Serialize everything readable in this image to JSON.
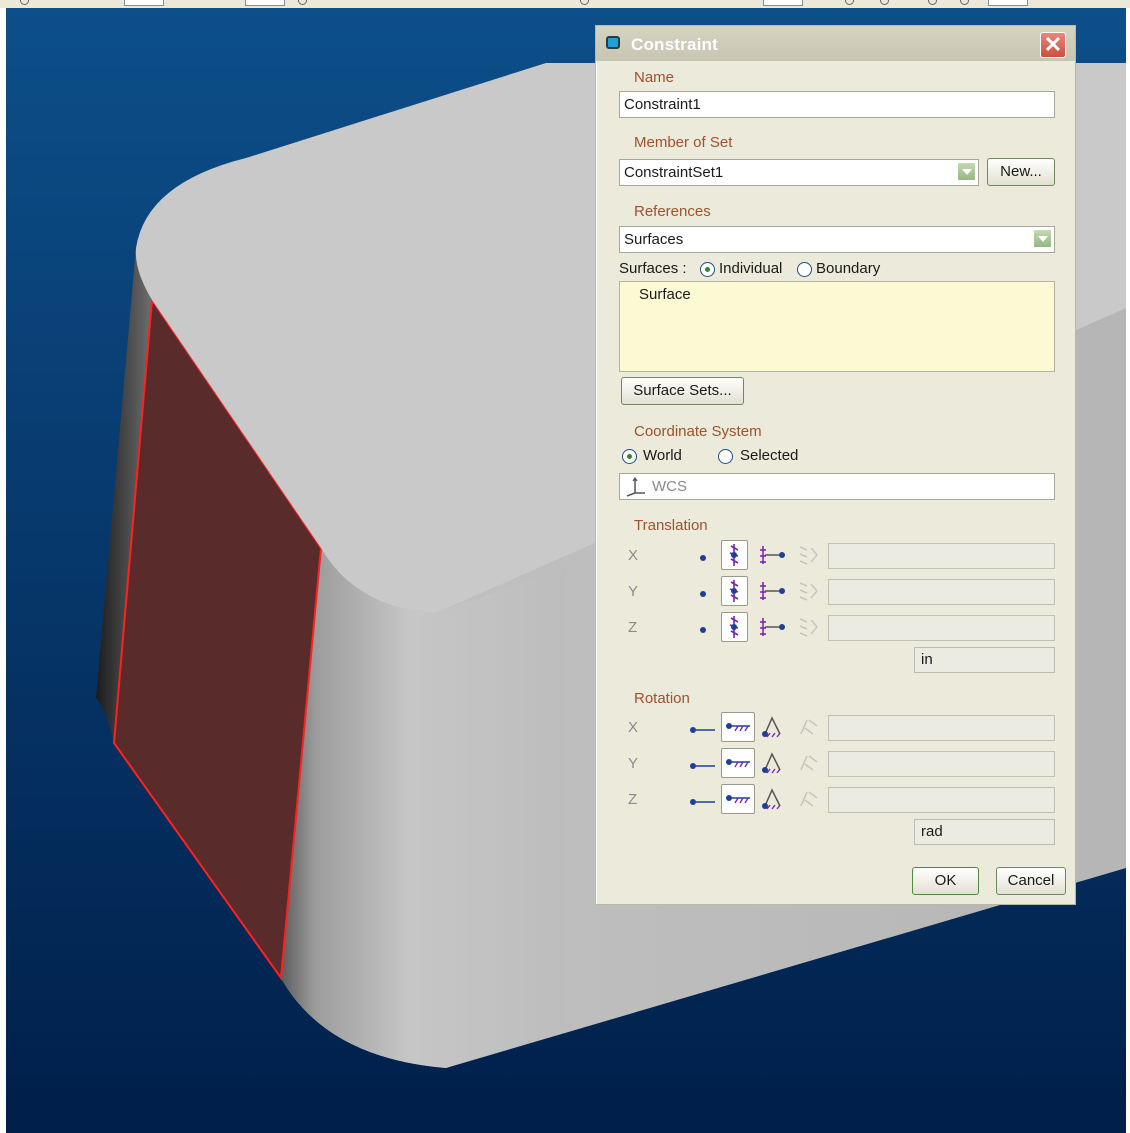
{
  "colors": {
    "viewport_top": "#0d4f8a",
    "viewport_bottom": "#001f4a",
    "selected_face": "#5a2b2b",
    "edge_highlight": "#ff2020",
    "label": "#a0522d"
  },
  "dialog": {
    "title": "Constraint",
    "close_label": "✕",
    "name": {
      "label": "Name",
      "value": "Constraint1"
    },
    "member_of_set": {
      "label": "Member of Set",
      "value": "ConstraintSet1",
      "new_button": "New..."
    },
    "references": {
      "label": "References",
      "value": "Surfaces"
    },
    "surfaces_mode": {
      "label": "Surfaces :",
      "options": [
        "Individual",
        "Boundary"
      ],
      "selected": "Individual"
    },
    "surface_list": [
      "Surface"
    ],
    "surface_sets_button": "Surface Sets...",
    "coordinate_system": {
      "label": "Coordinate System",
      "options": [
        "World",
        "Selected"
      ],
      "selected": "World",
      "value": "WCS"
    },
    "translation": {
      "label": "Translation",
      "axes": [
        "X",
        "Y",
        "Z"
      ],
      "unit": "in",
      "selected_mode": "fixed"
    },
    "rotation": {
      "label": "Rotation",
      "axes": [
        "X",
        "Y",
        "Z"
      ],
      "unit": "rad",
      "selected_mode": "fixed"
    },
    "ok_label": "OK",
    "cancel_label": "Cancel"
  }
}
